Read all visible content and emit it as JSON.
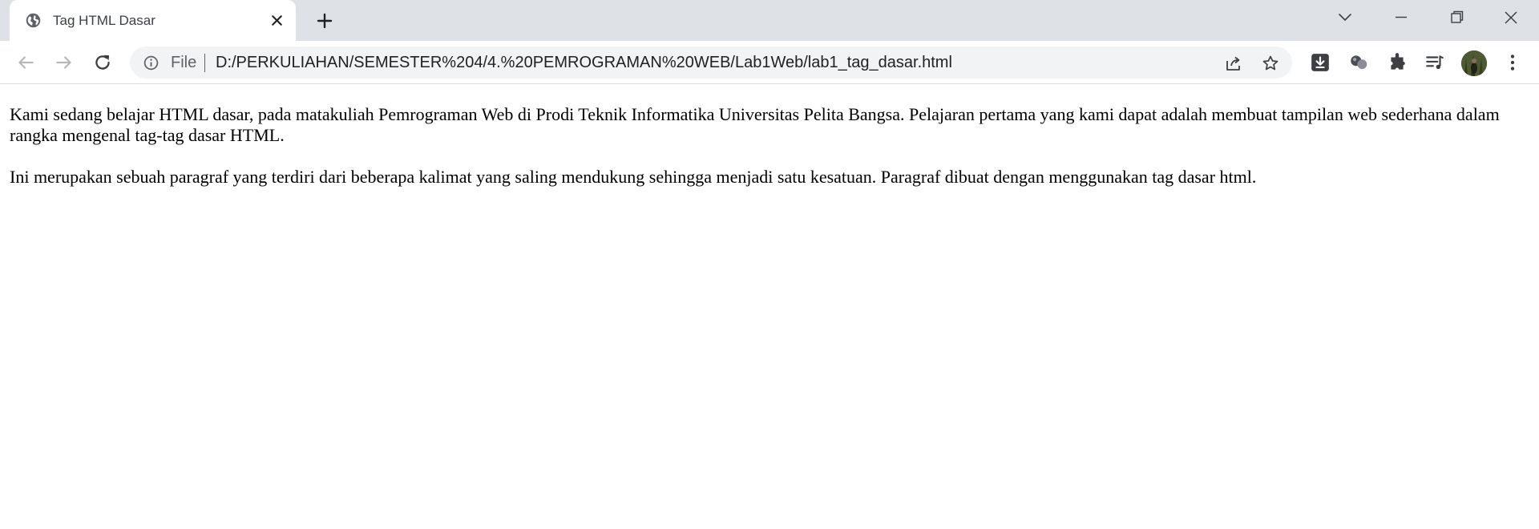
{
  "browser": {
    "tab": {
      "title": "Tag HTML Dasar"
    },
    "address_bar": {
      "scheme_label": "File",
      "url": "D:/PERKULIAHAN/SEMESTER%204/4.%20PEMROGRAMAN%20WEB/Lab1Web/lab1_tag_dasar.html"
    },
    "icons": {
      "tab_favicon": "globe-icon",
      "tab_close": "close-icon",
      "new_tab": "plus-icon",
      "tab_search": "chevron-down-icon",
      "minimize": "minimize-icon",
      "restore": "restore-icon",
      "close_window": "close-icon",
      "back": "back-arrow-icon",
      "forward": "forward-arrow-icon",
      "reload": "reload-icon",
      "site_info": "info-icon",
      "share": "share-icon",
      "bookmark": "star-icon",
      "extension_1": "download-extension-icon",
      "extension_2": "spheres-extension-icon",
      "extensions": "puzzle-icon",
      "media": "playlist-icon",
      "profile": "avatar",
      "menu": "kebab-menu-icon"
    },
    "colors": {
      "tabstrip_bg": "#dee1e6",
      "omnibox_bg": "#f1f3f4",
      "icon": "#5f6368"
    }
  },
  "page": {
    "paragraphs": [
      "Kami sedang belajar HTML dasar, pada matakuliah Pemrograman Web di Prodi Teknik Informatika Universitas Pelita Bangsa. Pelajaran pertama yang kami dapat adalah membuat tampilan web sederhana dalam rangka mengenal tag-tag dasar HTML.",
      "Ini merupakan sebuah paragraf yang terdiri dari beberapa kalimat yang saling mendukung sehingga menjadi satu kesatuan. Paragraf dibuat dengan menggunakan tag dasar html."
    ]
  }
}
